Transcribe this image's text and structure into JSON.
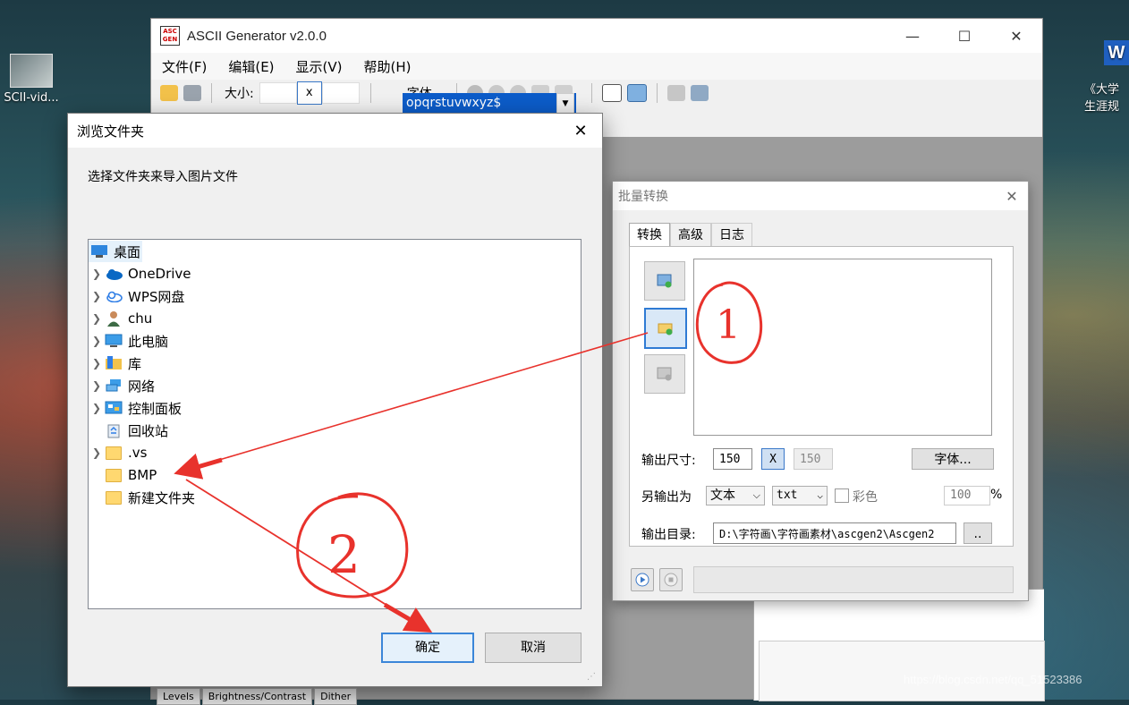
{
  "desktop": {
    "left_icon_label": "SCII-vid...",
    "word_letter": "W",
    "right_label_line1": "《大学",
    "right_label_line2": "生涯规",
    "watermark": "https://blog.csdn.net/qq_51523386"
  },
  "main_window": {
    "logo_text": "ASC GEN",
    "title": "ASCII Generator v2.0.0",
    "controls": {
      "minimize": "—",
      "maximize": "☐",
      "close": "✕"
    },
    "menu": [
      "文件(F)",
      "编辑(E)",
      "显示(V)",
      "帮助(H)"
    ],
    "toolbar": {
      "size_label": "大小:",
      "size_separator": "x",
      "font_button": "字体...",
      "charset_value": "opqrstuvwxyz$"
    },
    "bottom_tabs": [
      "Levels",
      "Brightness/Contrast",
      "Dither"
    ]
  },
  "batch_dialog": {
    "title": "批量转换",
    "close": "✕",
    "tabs": [
      "转换",
      "高级",
      "日志"
    ],
    "active_tab": "转换",
    "output_size_label": "输出尺寸:",
    "width_value": "150",
    "x_button": "X",
    "height_value": "150",
    "font_button": "字体...",
    "save_as_label": "另输出为",
    "format_value": "文本",
    "ext_value": "txt",
    "color_label": "彩色",
    "percent_value": "100",
    "percent_sign": "%",
    "output_dir_label": "输出目录:",
    "output_dir_value": "D:\\字符画\\字符画素材\\ascgen2\\Ascgen2",
    "browse_button": ".."
  },
  "browse_dialog": {
    "title": "浏览文件夹",
    "close": "✕",
    "description": "选择文件夹来导入图片文件",
    "tree": [
      {
        "label": "桌面",
        "icon": "desktop-icon",
        "expand": false,
        "level": 0,
        "selected": true
      },
      {
        "label": "OneDrive",
        "icon": "cloud-icon",
        "expand": true,
        "level": 1
      },
      {
        "label": "WPS网盘",
        "icon": "wps-cloud-icon",
        "expand": true,
        "level": 1
      },
      {
        "label": "chu",
        "icon": "user-icon",
        "expand": true,
        "level": 1
      },
      {
        "label": "此电脑",
        "icon": "computer-icon",
        "expand": true,
        "level": 1
      },
      {
        "label": "库",
        "icon": "library-icon",
        "expand": true,
        "level": 1
      },
      {
        "label": "网络",
        "icon": "network-icon",
        "expand": true,
        "level": 1
      },
      {
        "label": "控制面板",
        "icon": "control-panel-icon",
        "expand": true,
        "level": 1
      },
      {
        "label": "回收站",
        "icon": "recycle-bin-icon",
        "expand": false,
        "level": 1
      },
      {
        "label": ".vs",
        "icon": "folder-icon",
        "expand": true,
        "level": 1
      },
      {
        "label": "BMP",
        "icon": "folder-icon",
        "expand": false,
        "level": 1
      },
      {
        "label": "新建文件夹",
        "icon": "folder-icon",
        "expand": false,
        "level": 1
      }
    ],
    "ok_button": "确定",
    "cancel_button": "取消"
  },
  "annotations": {
    "step1": "1",
    "step2": "2",
    "color": "#e8322c"
  }
}
